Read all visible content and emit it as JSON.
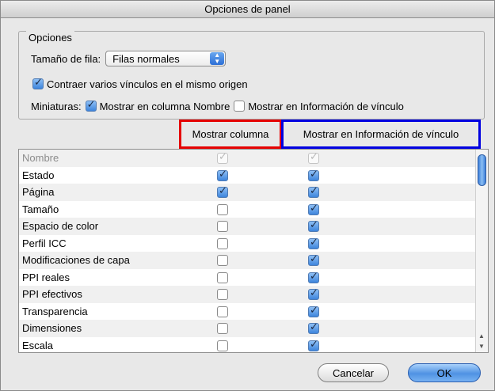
{
  "title": "Opciones de panel",
  "options": {
    "legend": "Opciones",
    "row_size_label": "Tamaño de fila:",
    "row_size_value": "Filas normales",
    "collapse_label": "Contraer varios vínculos en el mismo origen",
    "collapse_checked": true,
    "thumbnails_label": "Miniaturas:",
    "thumb_name_label": "Mostrar en columna Nombre",
    "thumb_name_checked": true,
    "thumb_info_label": "Mostrar en Información de vínculo",
    "thumb_info_checked": false
  },
  "columns": {
    "show_column": "Mostrar columna",
    "show_info": "Mostrar en Información de vínculo"
  },
  "rows": [
    {
      "label": "Nombre",
      "show_column": true,
      "show_info": true,
      "disabled": true
    },
    {
      "label": "Estado",
      "show_column": true,
      "show_info": true
    },
    {
      "label": "Página",
      "show_column": true,
      "show_info": true
    },
    {
      "label": "Tamaño",
      "show_column": false,
      "show_info": true
    },
    {
      "label": "Espacio de color",
      "show_column": false,
      "show_info": true
    },
    {
      "label": "Perfil ICC",
      "show_column": false,
      "show_info": true
    },
    {
      "label": "Modificaciones de capa",
      "show_column": false,
      "show_info": true
    },
    {
      "label": "PPI reales",
      "show_column": false,
      "show_info": true
    },
    {
      "label": "PPI efectivos",
      "show_column": false,
      "show_info": true
    },
    {
      "label": "Transparencia",
      "show_column": false,
      "show_info": true
    },
    {
      "label": "Dimensiones",
      "show_column": false,
      "show_info": true
    },
    {
      "label": "Escala",
      "show_column": false,
      "show_info": true
    }
  ],
  "buttons": {
    "cancel": "Cancelar",
    "ok": "OK"
  },
  "colors": {
    "highlight_show_column": "#e50000",
    "highlight_show_info": "#0000e0",
    "accent": "#3e85dc"
  }
}
